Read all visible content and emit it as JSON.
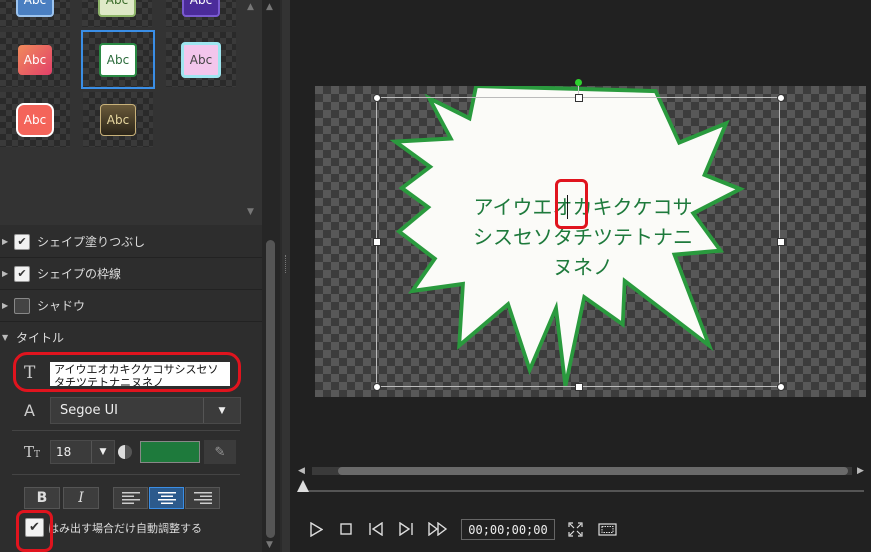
{
  "gallery": {
    "thumbs": [
      {
        "label": "Abc"
      },
      {
        "label": "Abc"
      },
      {
        "label": "Abc"
      },
      {
        "label": "Abc"
      },
      {
        "label": "Abc"
      },
      {
        "label": "Abc"
      },
      {
        "label": "Abc"
      },
      {
        "label": "Abc"
      }
    ]
  },
  "properties": {
    "shape_fill": "シェイプ塗りつぶし",
    "shape_border": "シェイプの枠線",
    "shadow": "シャドウ",
    "title_section": "タイトル"
  },
  "title_text": {
    "value": "アイウエオカキクケコサシスセソタチツテトナニヌネノ"
  },
  "font": {
    "family": "Segoe UI",
    "size": "18",
    "color": "#1e7a3c"
  },
  "auto_fit": {
    "label": "はみ出す場合だけ自動調整する",
    "checked": true
  },
  "preview": {
    "lines": [
      "アイウエオカキクケコサ",
      "シスセソタチツテトナニ",
      "ヌネノ"
    ]
  },
  "playback": {
    "timecode": "00;00;00;00"
  },
  "colors": {
    "accent": "#3a8ee6",
    "highlight": "#e0141e",
    "shape_border": "#2a9a3e"
  }
}
